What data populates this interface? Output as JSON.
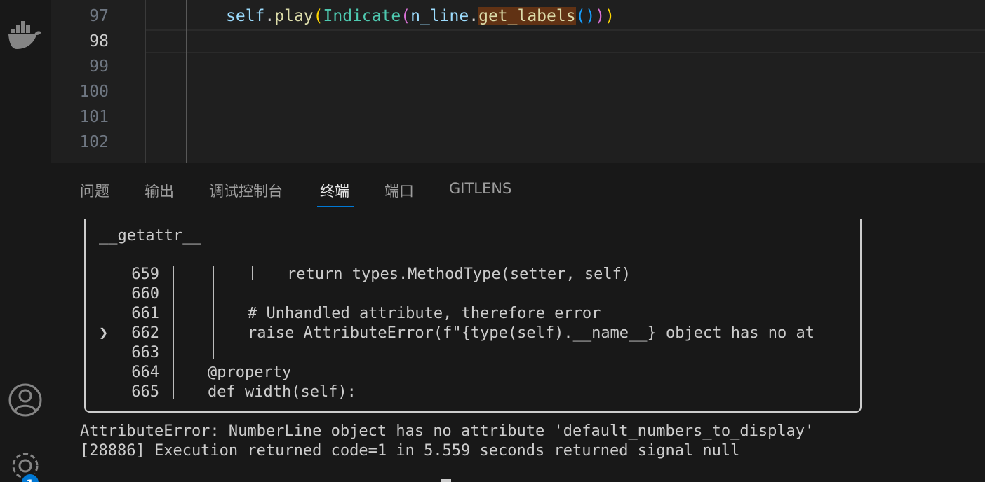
{
  "activity_bar": {
    "icons": [
      "docker-icon",
      "account-icon",
      "settings-gear-icon"
    ],
    "settings_badge": "1"
  },
  "editor": {
    "line_numbers": [
      "97",
      "98",
      "99",
      "100",
      "101",
      "102"
    ],
    "active_line": "98",
    "code_line_97": {
      "t1": "self",
      "t2": ".",
      "t3": "play",
      "t4": "(",
      "t5": "Indicate",
      "t6": "(",
      "t7": "n_line",
      "t8": ".",
      "t9": "get_labels",
      "t10": "()",
      "t11": ")",
      "t12": ")"
    }
  },
  "panel": {
    "tabs": [
      {
        "label": "问题"
      },
      {
        "label": "输出"
      },
      {
        "label": "调试控制台"
      },
      {
        "label": "终端"
      },
      {
        "label": "端口"
      },
      {
        "label": "GITLENS"
      }
    ],
    "active_tab": "终端"
  },
  "terminal": {
    "frame_header": "__getattr__",
    "rows": [
      {
        "num": "659",
        "code": "return types.MethodType(setter, self)"
      },
      {
        "num": "660",
        "code": ""
      },
      {
        "num": "661",
        "code": "# Unhandled attribute, therefore error"
      },
      {
        "num": "662",
        "code": "raise AttributeError(f\"{type(self).__name__} object has no at"
      },
      {
        "num": "663",
        "code": ""
      },
      {
        "num": "664",
        "code": "@property"
      },
      {
        "num": "665",
        "code": "def width(self):"
      }
    ],
    "current_marker": "❯",
    "error_line": "AttributeError: NumberLine object has no attribute 'default_numbers_to_display'",
    "exec_line": "[28886] Execution returned code=1 in 5.559 seconds returned signal null"
  }
}
